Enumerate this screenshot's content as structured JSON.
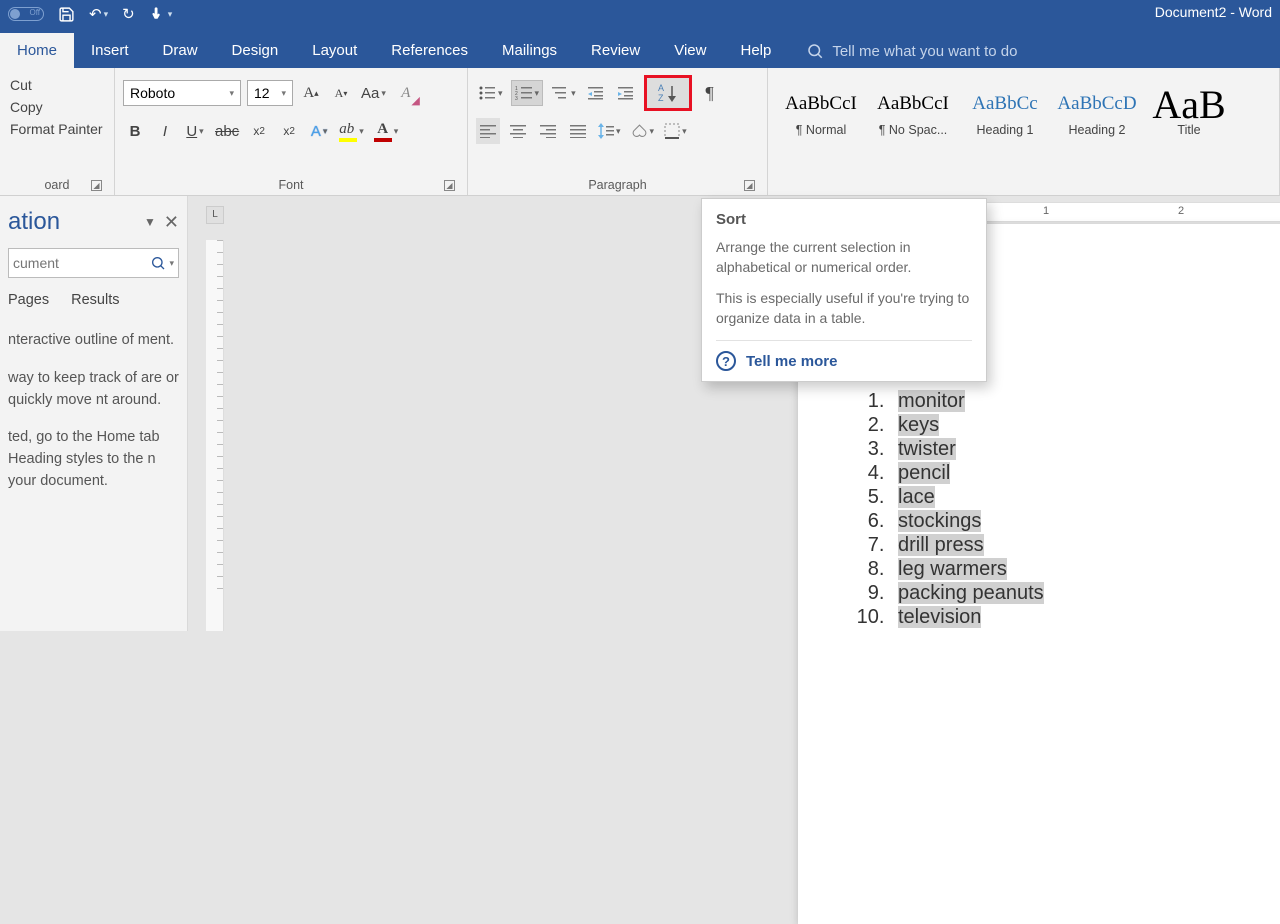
{
  "title": "Document2 - Word",
  "qat_toggle_label": "Off",
  "tabs": [
    "Home",
    "Insert",
    "Draw",
    "Design",
    "Layout",
    "References",
    "Mailings",
    "Review",
    "View",
    "Help"
  ],
  "tellme_placeholder": "Tell me what you want to do",
  "clipboard": {
    "cut": "Cut",
    "copy": "Copy",
    "fp": "Format Painter",
    "label": "oard"
  },
  "font": {
    "name": "Roboto",
    "size": "12",
    "label": "Font"
  },
  "paragraph": {
    "label": "Paragraph"
  },
  "styles": [
    {
      "preview": "AaBbCcI",
      "name": "¶ Normal",
      "cls": ""
    },
    {
      "preview": "AaBbCcI",
      "name": "¶ No Spac...",
      "cls": ""
    },
    {
      "preview": "AaBbCc",
      "name": "Heading 1",
      "cls": "blue"
    },
    {
      "preview": "AaBbCcD",
      "name": "Heading 2",
      "cls": "blue"
    },
    {
      "preview": "AaB",
      "name": "Title",
      "cls": "big"
    }
  ],
  "nav": {
    "title": "ation",
    "search_placeholder": "cument",
    "tabs": [
      "Pages",
      "Results"
    ],
    "p1": "nteractive outline of ment.",
    "p2": "way to keep track of are or quickly move nt around.",
    "p3": "ted, go to the Home tab Heading styles to the n your document."
  },
  "tooltip": {
    "title": "Sort",
    "body1": "Arrange the current selection in alphabetical or numerical order.",
    "body2": "This is especially useful if you're trying to organize data in a table.",
    "more": "Tell me more"
  },
  "list": [
    "monitor",
    "keys",
    "twister",
    "pencil",
    "lace",
    "stockings",
    "drill press",
    "leg warmers",
    "packing peanuts",
    "television"
  ],
  "ruler": {
    "n1": "1",
    "n2": "2"
  }
}
